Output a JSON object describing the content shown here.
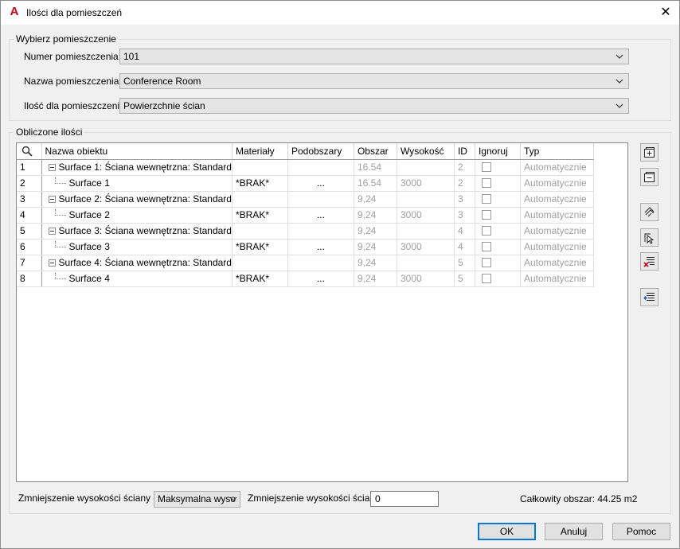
{
  "window": {
    "title": "Ilości dla pomieszczeń",
    "app_icon": "A",
    "close_glyph": "✕"
  },
  "select_room": {
    "legend": "Wybierz pomieszczenie",
    "room_number_label": "Numer pomieszczenia:",
    "room_number_value": "101",
    "room_name_label": "Nazwa pomieszczenia:",
    "room_name_value": "Conference Room",
    "quantity_label": "Ilość dla pomieszczenia:",
    "quantity_value": "Powierzchnie ścian"
  },
  "computed": {
    "legend": "Obliczone ilości",
    "columns": [
      "Nazwa obiektu",
      "Materiały",
      "Podobszary",
      "Obszar",
      "Wysokość",
      "ID",
      "Ignoruj",
      "Typ"
    ],
    "rows": [
      {
        "num": "1",
        "name": "Surface 1: Ściana wewnętrzna: Standard",
        "parent": true,
        "material": "",
        "sub": "",
        "area": "16.54",
        "height": "",
        "id": "2",
        "type": "Automatycznie"
      },
      {
        "num": "2",
        "name": "Surface 1",
        "parent": false,
        "material": "*BRAK*",
        "sub": "...",
        "area": "16.54",
        "height": "3000",
        "id": "2",
        "type": "Automatycznie"
      },
      {
        "num": "3",
        "name": "Surface 2: Ściana wewnętrzna: Standard",
        "parent": true,
        "material": "",
        "sub": "",
        "area": "9,24",
        "height": "",
        "id": "3",
        "type": "Automatycznie"
      },
      {
        "num": "4",
        "name": "Surface 2",
        "parent": false,
        "material": "*BRAK*",
        "sub": "...",
        "area": "9,24",
        "height": "3000",
        "id": "3",
        "type": "Automatycznie"
      },
      {
        "num": "5",
        "name": "Surface 3: Ściana wewnętrzna: Standard",
        "parent": true,
        "material": "",
        "sub": "",
        "area": "9,24",
        "height": "",
        "id": "4",
        "type": "Automatycznie"
      },
      {
        "num": "6",
        "name": "Surface 3",
        "parent": false,
        "material": "*BRAK*",
        "sub": "...",
        "area": "9,24",
        "height": "3000",
        "id": "4",
        "type": "Automatycznie"
      },
      {
        "num": "7",
        "name": "Surface 4: Ściana wewnętrzna: Standard",
        "parent": true,
        "material": "",
        "sub": "",
        "area": "9,24",
        "height": "",
        "id": "5",
        "type": "Automatycznie"
      },
      {
        "num": "8",
        "name": "Surface 4",
        "parent": false,
        "material": "*BRAK*",
        "sub": "...",
        "area": "9,24",
        "height": "3000",
        "id": "5",
        "type": "Automatycznie"
      }
    ]
  },
  "bottom": {
    "reduce_from_label": "Zmniejszenie wysokości ściany od",
    "reduce_from_value": "Maksymalna wyso",
    "reduce_label": "Zmniejszenie wysokości ściany",
    "reduce_value": "0",
    "total_area_text": "Całkowity obszar: 44.25 m2"
  },
  "buttons": {
    "ok": "OK",
    "cancel": "Anuluj",
    "help": "Pomoc"
  },
  "side_tools": [
    "expand-all-icon",
    "collapse-all-icon",
    "select-objects-icon",
    "pick-objects-icon",
    "remove-rows-icon",
    "insert-row-icon"
  ]
}
